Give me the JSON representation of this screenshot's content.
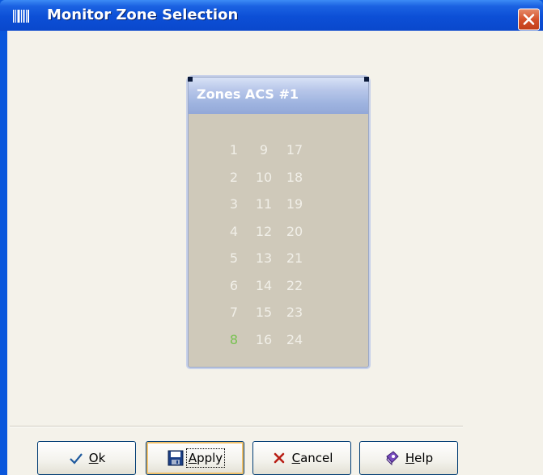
{
  "window": {
    "title": "Monitor Zone Selection"
  },
  "panel": {
    "title": "Zones ACS #1",
    "active_color": "#78c251",
    "zones": [
      {
        "label": "1",
        "active": false
      },
      {
        "label": "2",
        "active": false
      },
      {
        "label": "3",
        "active": false
      },
      {
        "label": "4",
        "active": false
      },
      {
        "label": "5",
        "active": false
      },
      {
        "label": "6",
        "active": false
      },
      {
        "label": "7",
        "active": false
      },
      {
        "label": "8",
        "active": true
      },
      {
        "label": "9",
        "active": false
      },
      {
        "label": "10",
        "active": false
      },
      {
        "label": "11",
        "active": false
      },
      {
        "label": "12",
        "active": false
      },
      {
        "label": "13",
        "active": false
      },
      {
        "label": "14",
        "active": false
      },
      {
        "label": "15",
        "active": false
      },
      {
        "label": "16",
        "active": false
      },
      {
        "label": "17",
        "active": false
      },
      {
        "label": "18",
        "active": false
      },
      {
        "label": "19",
        "active": false
      },
      {
        "label": "20",
        "active": false
      },
      {
        "label": "21",
        "active": false
      },
      {
        "label": "22",
        "active": false
      },
      {
        "label": "23",
        "active": false
      },
      {
        "label": "24",
        "active": false
      }
    ]
  },
  "buttons": {
    "ok": {
      "mnemonic": "O",
      "rest": "k",
      "icon": "checkmark-icon"
    },
    "apply": {
      "mnemonic": "A",
      "rest": "pply",
      "icon": "save-disk-icon"
    },
    "cancel": {
      "mnemonic": "C",
      "rest": "ancel",
      "icon": "x-mark-icon"
    },
    "help": {
      "mnemonic": "H",
      "rest": "elp",
      "icon": "help-book-icon"
    }
  }
}
